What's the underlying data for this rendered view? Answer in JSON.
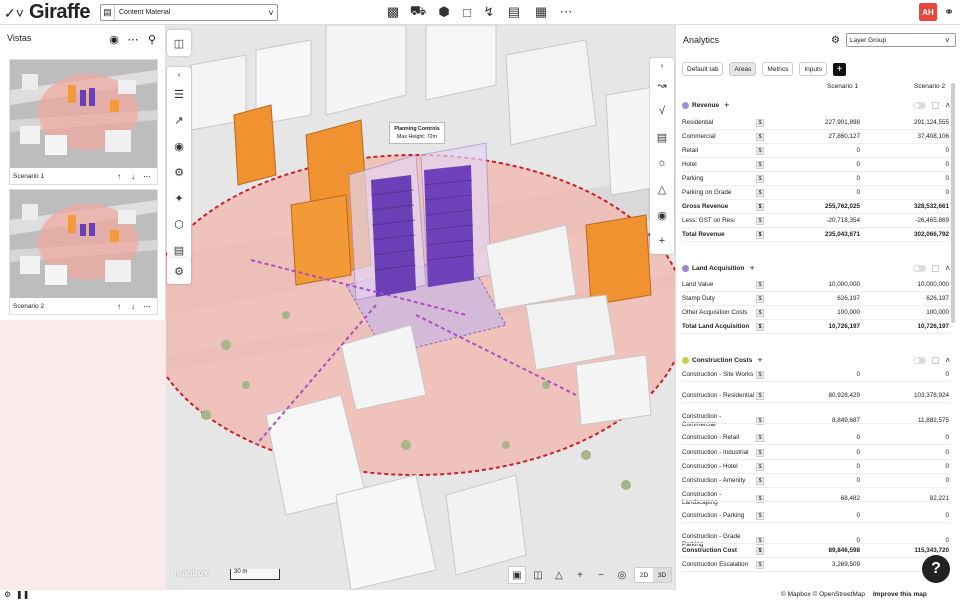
{
  "topbar": {
    "brand": "Giraffe",
    "project_select": "Content Material",
    "avatar_initials": "AH",
    "tools": [
      "building-icon",
      "truck-icon",
      "cube-icon",
      "frame-icon",
      "bolt-icon",
      "chat-icon",
      "calendar-icon",
      "more-icon"
    ]
  },
  "vistas": {
    "title": "Vistas",
    "items": [
      {
        "label": "Scenario 1"
      },
      {
        "label": "Scenario 2"
      }
    ]
  },
  "map": {
    "tooltip_title": "Planning Controls",
    "tooltip_sub": "Max Height: 72m",
    "logo": "mapbox",
    "scale": "30 m",
    "mode_2d": "2D",
    "mode_3d": "3D"
  },
  "analytics": {
    "title": "Analytics",
    "layer_select": "Layer Group",
    "tabs": [
      "Default tab",
      "Areas",
      "Metrics",
      "Inputs"
    ],
    "scenario1": "Scenario 1",
    "scenario2": "Scenario 2",
    "colors": {
      "revenue": "#a98ad6",
      "land": "#9a88c8",
      "construction": "#c8d04a"
    },
    "groups": [
      {
        "name": "Revenue",
        "rows": [
          {
            "label": "Residential",
            "s1": "227,901,898",
            "s2": "291,124,555",
            "bold": false
          },
          {
            "label": "Commercial",
            "s1": "27,860,127",
            "s2": "37,408,106",
            "bold": false
          },
          {
            "label": "Retail",
            "s1": "0",
            "s2": "0",
            "bold": false
          },
          {
            "label": "Hotel",
            "s1": "0",
            "s2": "0",
            "bold": false
          },
          {
            "label": "Parking",
            "s1": "0",
            "s2": "0",
            "bold": false
          },
          {
            "label": "Parking on Grade",
            "s1": "0",
            "s2": "0",
            "bold": false
          },
          {
            "label": "Gross Revenue",
            "s1": "255,762,025",
            "s2": "328,532,661",
            "bold": true
          },
          {
            "label": "Less: GST on Resi",
            "s1": "-20,718,354",
            "s2": "-26,465,869",
            "bold": false
          },
          {
            "label": "Total Revenue",
            "s1": "235,043,671",
            "s2": "302,066,792",
            "bold": true
          }
        ]
      },
      {
        "name": "Land Acquisition",
        "rows": [
          {
            "label": "Land Value",
            "s1": "10,000,000",
            "s2": "10,000,000",
            "bold": false
          },
          {
            "label": "Stamp Duty",
            "s1": "626,197",
            "s2": "626,197",
            "bold": false
          },
          {
            "label": "Other Acquisition Costs",
            "s1": "100,000",
            "s2": "100,000",
            "bold": false
          },
          {
            "label": "Total Land Acquisition",
            "s1": "10,726,197",
            "s2": "10,726,197",
            "bold": true
          }
        ]
      },
      {
        "name": "Construction Costs",
        "rows": [
          {
            "label": "Construction - Site Works",
            "s1": "0",
            "s2": "0",
            "bold": false
          },
          {
            "label": "Construction - Residential",
            "s1": "80,928,429",
            "s2": "103,378,924",
            "bold": false
          },
          {
            "label": "Construction - Commercial",
            "s1": "8,849,687",
            "s2": "11,882,575",
            "bold": false
          },
          {
            "label": "Construction - Retail",
            "s1": "0",
            "s2": "0",
            "bold": false
          },
          {
            "label": "Construction - Industrial",
            "s1": "0",
            "s2": "0",
            "bold": false
          },
          {
            "label": "Construction - Hotel",
            "s1": "0",
            "s2": "0",
            "bold": false
          },
          {
            "label": "Construction - Amenity",
            "s1": "0",
            "s2": "0",
            "bold": false
          },
          {
            "label": "Construction - Landscaping",
            "s1": "68,482",
            "s2": "82,221",
            "bold": false
          },
          {
            "label": "Construction - Parking",
            "s1": "0",
            "s2": "0",
            "bold": false
          },
          {
            "label": "Construction - Grade Parking",
            "s1": "0",
            "s2": "0",
            "bold": false
          },
          {
            "label": "Construction Cost",
            "s1": "89,846,598",
            "s2": "115,343,720",
            "bold": true
          },
          {
            "label": "Construction Escalation",
            "s1": "3,269,509",
            "s2": "4,1",
            "bold": false
          }
        ]
      }
    ]
  },
  "footer": {
    "attribution": "© Mapbox © OpenStreetMap",
    "improve": "Improve this map"
  }
}
